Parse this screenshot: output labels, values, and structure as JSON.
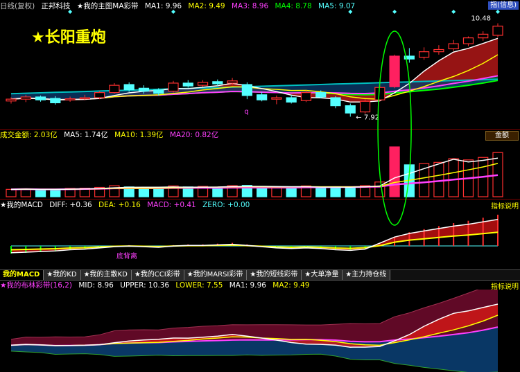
{
  "main_header": {
    "period": "日线(复权)",
    "stock": "正邦科技",
    "indicator": "★我的主图MA彩带",
    "ma1": "MA1: 9.96",
    "ma2": "MA2: 9.49",
    "ma3": "MA3: 8.96",
    "ma4": "MA4: 8.78",
    "ma5": "MA5: 9.07",
    "button": "指(信息)"
  },
  "banner": "★长阳重炮",
  "price_labels": {
    "high": "10.48",
    "low": "7.92",
    "q_marker": "q"
  },
  "volume_header": {
    "label": "成交金额: 2.03亿",
    "ma5": "MA5: 1.74亿",
    "ma10": "MA10: 1.39亿",
    "ma20": "MA20: 0.82亿",
    "button": "金额"
  },
  "macd_header": {
    "name": "★我的MACD",
    "diff": "DIFF: +0.36",
    "dea": "DEA: +0.16",
    "macd": "MACD: +0.41",
    "zero": "ZERO: +0.00",
    "help": "指标说明"
  },
  "macd_annotation": "底背离",
  "tabs": [
    "我的MACD",
    "★我的KD",
    "★我的主散KD",
    "★我的CCI彩带",
    "★我的MARSI彩带",
    "★我的短线彩带",
    "★大单净量",
    "★主力持仓线"
  ],
  "boll_header": {
    "name": "★我的布林彩带(16,2)",
    "mid": "MID: 8.96",
    "upper": "UPPER: 10.36",
    "lower": "LOWER: 7.55",
    "ma1": "MA1: 9.96",
    "ma2": "MA2: 9.49",
    "help": "指标说明"
  },
  "colors": {
    "up": "#ff3030",
    "down": "#54ffff",
    "ma_yellow": "#ffff00",
    "ma_white": "#ffffff",
    "ma_magenta": "#ff40ff",
    "ma_green": "#00ff00",
    "ma_cyan": "#00c0c0",
    "highlight_ellipse": "#00ff00"
  },
  "candles": [
    {
      "o": 8.35,
      "c": 8.4,
      "h": 8.45,
      "l": 8.28
    },
    {
      "o": 8.4,
      "c": 8.46,
      "h": 8.52,
      "l": 8.32
    },
    {
      "o": 8.46,
      "c": 8.38,
      "h": 8.5,
      "l": 8.33
    },
    {
      "o": 8.42,
      "c": 8.3,
      "h": 8.48,
      "l": 8.25
    },
    {
      "o": 8.38,
      "c": 8.41,
      "h": 8.47,
      "l": 8.33
    },
    {
      "o": 8.41,
      "c": 8.44,
      "h": 8.52,
      "l": 8.37
    },
    {
      "o": 8.44,
      "c": 8.58,
      "h": 8.62,
      "l": 8.4
    },
    {
      "o": 8.58,
      "c": 8.78,
      "h": 8.84,
      "l": 8.55
    },
    {
      "o": 8.8,
      "c": 8.66,
      "h": 8.86,
      "l": 8.6
    },
    {
      "o": 8.7,
      "c": 8.62,
      "h": 8.78,
      "l": 8.55
    },
    {
      "o": 8.65,
      "c": 8.56,
      "h": 8.7,
      "l": 8.5
    },
    {
      "o": 8.62,
      "c": 8.84,
      "h": 8.9,
      "l": 8.58
    },
    {
      "o": 8.84,
      "c": 8.76,
      "h": 8.92,
      "l": 8.72
    },
    {
      "o": 8.78,
      "c": 8.86,
      "h": 8.92,
      "l": 8.74
    },
    {
      "o": 8.88,
      "c": 8.82,
      "h": 8.94,
      "l": 8.75
    },
    {
      "o": 8.84,
      "c": 8.9,
      "h": 8.98,
      "l": 8.78
    },
    {
      "o": 8.8,
      "c": 8.5,
      "h": 8.86,
      "l": 8.4
    },
    {
      "o": 8.52,
      "c": 8.38,
      "h": 8.6,
      "l": 8.34
    },
    {
      "o": 8.4,
      "c": 8.44,
      "h": 8.5,
      "l": 8.26
    },
    {
      "o": 8.44,
      "c": 8.32,
      "h": 8.52,
      "l": 8.28
    },
    {
      "o": 8.36,
      "c": 8.58,
      "h": 8.64,
      "l": 8.32
    },
    {
      "o": 8.58,
      "c": 8.46,
      "h": 8.64,
      "l": 8.42
    },
    {
      "o": 8.44,
      "c": 8.22,
      "h": 8.48,
      "l": 8.15
    },
    {
      "o": 8.22,
      "c": 8.02,
      "h": 8.28,
      "l": 7.92
    },
    {
      "o": 8.05,
      "c": 8.34,
      "h": 8.4,
      "l": 8.0
    },
    {
      "o": 8.38,
      "c": 8.72,
      "h": 8.78,
      "l": 8.34
    },
    {
      "o": 8.74,
      "c": 9.58,
      "h": 9.62,
      "l": 8.7
    },
    {
      "o": 9.58,
      "c": 9.5,
      "h": 9.8,
      "l": 9.4
    },
    {
      "o": 9.55,
      "c": 9.7,
      "h": 9.82,
      "l": 9.48
    },
    {
      "o": 9.7,
      "c": 9.76,
      "h": 9.88,
      "l": 9.62
    },
    {
      "o": 9.78,
      "c": 9.92,
      "h": 10.02,
      "l": 9.72
    },
    {
      "o": 9.92,
      "c": 10.08,
      "h": 10.12,
      "l": 9.85
    },
    {
      "o": 10.08,
      "c": 10.18,
      "h": 10.26,
      "l": 10.0
    },
    {
      "o": 10.15,
      "c": 10.4,
      "h": 10.48,
      "l": 10.1
    }
  ],
  "volume": [
    0.3,
    0.32,
    0.28,
    0.3,
    0.34,
    0.35,
    0.38,
    0.45,
    0.4,
    0.36,
    0.34,
    0.44,
    0.4,
    0.42,
    0.38,
    0.45,
    0.46,
    0.4,
    0.38,
    0.36,
    0.44,
    0.38,
    0.4,
    0.36,
    0.45,
    0.6,
    2.03,
    1.3,
    1.35,
    1.4,
    1.55,
    1.5,
    1.6,
    1.8
  ],
  "macd_hist": [
    -0.1,
    -0.09,
    -0.08,
    -0.07,
    -0.05,
    -0.04,
    -0.02,
    0.0,
    0.01,
    0.0,
    -0.01,
    0.01,
    0.02,
    0.02,
    0.03,
    0.04,
    0.02,
    0.0,
    -0.02,
    -0.03,
    -0.02,
    -0.03,
    -0.05,
    -0.06,
    -0.04,
    0.02,
    0.12,
    0.18,
    0.22,
    0.26,
    0.3,
    0.33,
    0.37,
    0.41
  ]
}
